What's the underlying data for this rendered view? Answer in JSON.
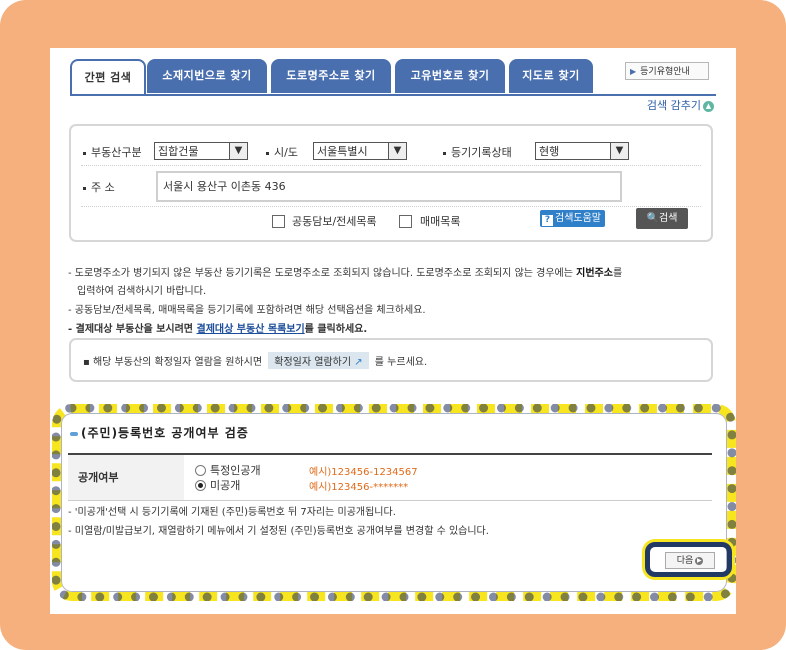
{
  "tabs": [
    "간편 검색",
    "소재지번으로 찾기",
    "도로명주소로 찾기",
    "고유번호로 찾기",
    "지도로 찾기"
  ],
  "guide_button": "등기유형안내",
  "fold_link": "검색 감추기",
  "form": {
    "type_label": "부동산구분",
    "type_value": "집합건물",
    "region_label": "시/도",
    "region_value": "서울특별시",
    "status_label": "등기기록상태",
    "status_value": "현행",
    "addr_label": "주 소",
    "addr_value": "서울시 용산구 이촌동 436",
    "chk1": "공동담보/전세목록",
    "chk2": "매매목록",
    "help_button": "검색도움말",
    "search_button": "검색"
  },
  "notes": {
    "n1a": "도로명주소가 병기되지 않은 부동산 등기기록은 도로명주소로 조회되지 않습니다. 도로명주소로 조회되지 않는 경우에는 ",
    "n1b": "지번주소",
    "n1c": "를",
    "n1d": "입력하여 검색하시기 바랍니다.",
    "n2": "공동담보/전세목록, 매매목록을 등기기록에 포함하려면 해당 선택옵션을 체크하세요.",
    "n3a": "결제대상 부동산을 보시려면 ",
    "n3b": "결제대상 부동산 목록보기",
    "n3c": "를 클릭하세요.",
    "info_a": "해당 부동산의 확정일자 열람을 원하시면 ",
    "info_btn": "확정일자 열람하기",
    "info_b": " 를 누르세요."
  },
  "verify": {
    "title": "(주민)등록번호 공개여부 검증",
    "row_header": "공개여부",
    "opt1": "특정인공개",
    "opt1_example": "예시)123456-1234567",
    "opt2": "미공개",
    "opt2_example": "예시)123456-*******",
    "note1": "'미공개'선택 시 등기기록에 기재된 (주민)등록번호 뒤 7자리는 미공개됩니다.",
    "note2": "미열람/미발급보기, 재열람하기 메뉴에서 기 설정된 (주민)등록번호 공개여부를 변경할 수 있습니다.",
    "next_button": "다음"
  },
  "colors": {
    "tab_blue": "#4a6fae",
    "highlight_yellow": "#f7e520",
    "highlight_navy": "#223a63",
    "example_orange": "#e06b1a"
  }
}
